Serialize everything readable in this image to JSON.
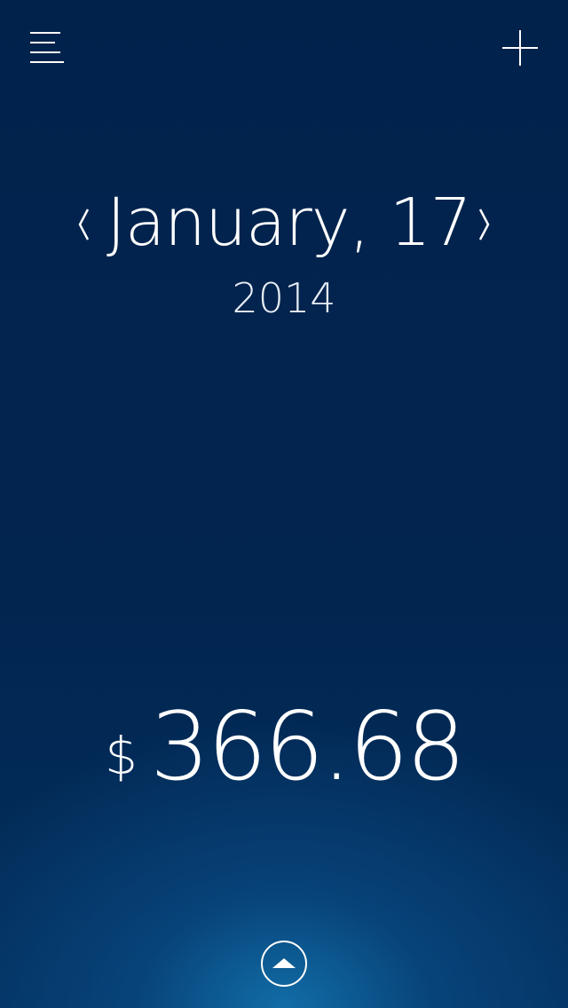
{
  "header": {
    "menu_icon": "menu-icon",
    "add_icon": "plus-icon"
  },
  "date": {
    "prev_icon": "chevron-left-icon",
    "label": "January,  17",
    "next_icon": "chevron-right-icon",
    "year": "2014"
  },
  "total": {
    "currency": "$",
    "amount": "366.68"
  },
  "footer": {
    "expand_icon": "chevron-up-circle-icon"
  },
  "colors": {
    "background_top": "#01224b",
    "background_glow": "#1270aa",
    "foreground": "#ffffff"
  }
}
